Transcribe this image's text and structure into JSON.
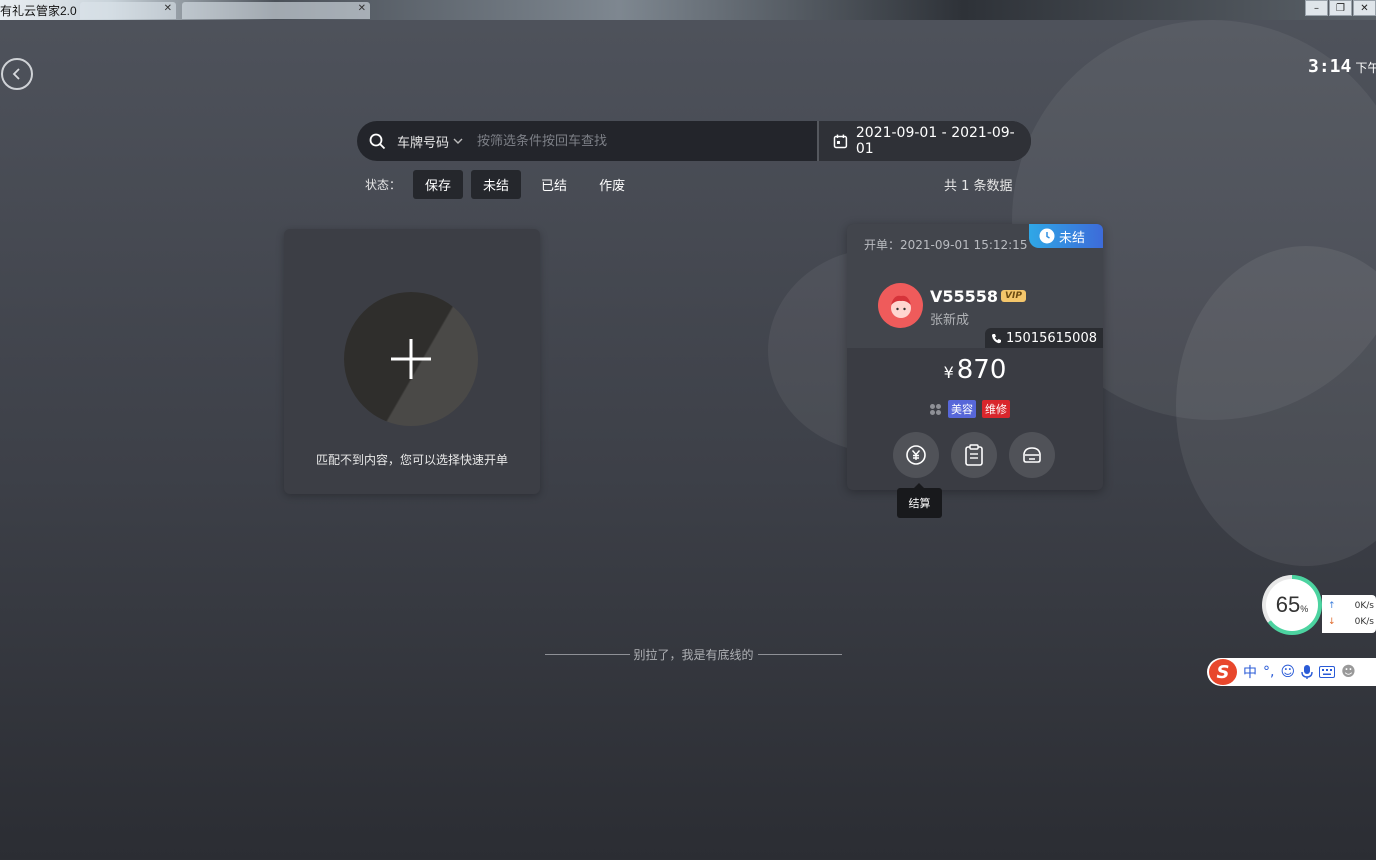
{
  "window": {
    "title": "有礼云管家2.0",
    "controls": [
      "–",
      "❐",
      "✕"
    ]
  },
  "clock": {
    "time": "3:14",
    "ampm": "下午"
  },
  "search": {
    "field": "车牌号码",
    "placeholder": "按筛选条件按回车查找",
    "date_range": "2021-09-01 - 2021-09-01"
  },
  "status": {
    "label": "状态：",
    "chips": [
      {
        "label": "保存",
        "active": true
      },
      {
        "label": "未结",
        "active": true
      },
      {
        "label": "已结",
        "active": false
      },
      {
        "label": "作废",
        "active": false
      }
    ],
    "count_text": "共 1 条数据"
  },
  "quick_card": {
    "hint": "匹配不到内容，您可以选择快速开单"
  },
  "order": {
    "open_time": "开单：2021-09-01 15:12:15",
    "status_badge": "未结",
    "plate": "V55558",
    "vip": "VIP",
    "owner": "张新成",
    "phone": "15015615008",
    "currency": "¥",
    "amount": "870",
    "tags": [
      "美容",
      "维修"
    ],
    "actions": [
      "settle-icon",
      "clipboard-icon",
      "car-icon"
    ],
    "tooltip": "结算"
  },
  "footer": {
    "text": "别拉了，我是有底线的"
  },
  "net": {
    "percent": "65",
    "unit": "%",
    "up": "0K/s",
    "down": "0K/s"
  },
  "ime": {
    "lang": "中",
    "punct": "°,"
  },
  "colors": {
    "accent": "#2fa7e6",
    "danger": "#d9262c",
    "beauty": "#5767d9",
    "vip": "#f4c66b"
  }
}
